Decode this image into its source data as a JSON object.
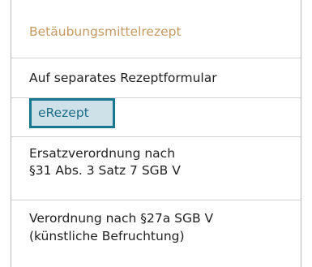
{
  "menu": {
    "items": [
      {
        "label": "Betäubungsmittelrezept",
        "disabled": true
      },
      {
        "label": "Auf separates Rezeptformular"
      },
      {
        "label": "eRezept",
        "selected": true
      },
      {
        "lines": [
          "Ersatzverordnung nach",
          "§31 Abs. 3 Satz 7 SGB V"
        ]
      },
      {
        "lines": [
          "Verordnung nach §27a SGB V",
          "(künstliche Befruchtung)"
        ]
      }
    ]
  },
  "colors": {
    "disabled_text": "#c59a62",
    "selected_border": "#16778f",
    "selected_fill": "#cfe1e8",
    "selected_text": "#1b6c86"
  }
}
